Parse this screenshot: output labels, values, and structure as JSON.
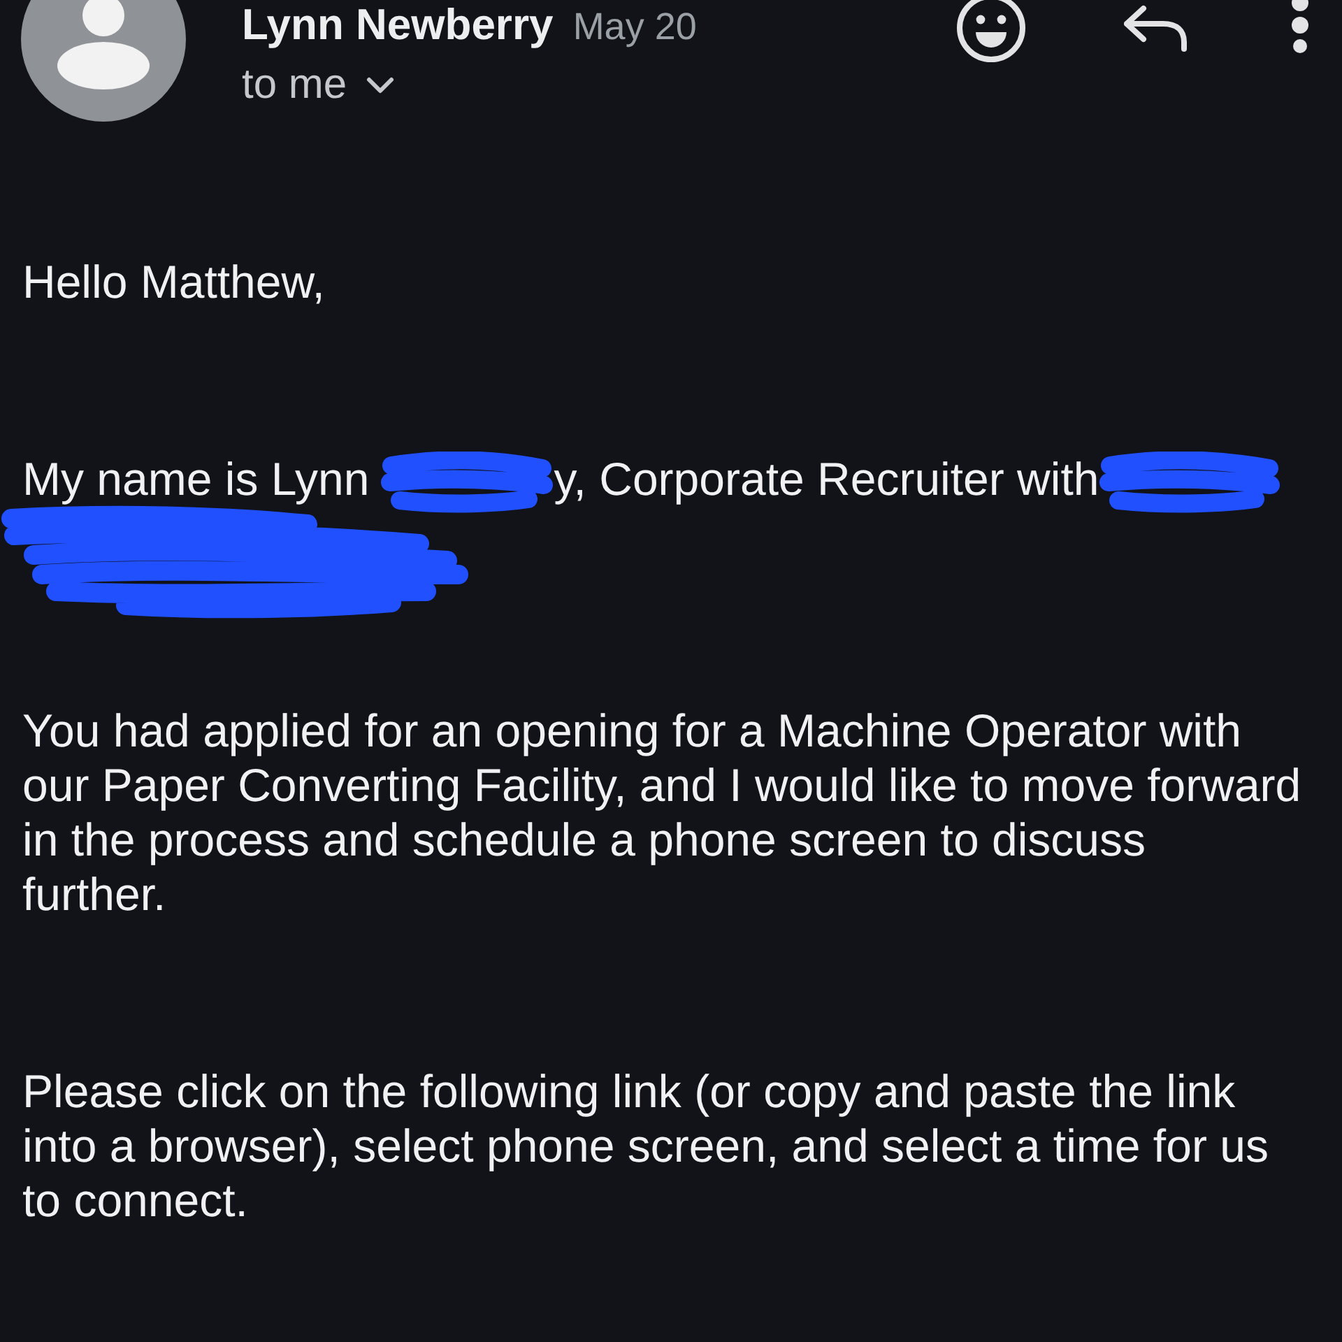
{
  "header": {
    "sender": "Lynn Newberry",
    "date": "May 20",
    "recipient": "to me"
  },
  "body": [
    {
      "kind": "text",
      "text": "Hello Matthew,"
    },
    {
      "kind": "mixed",
      "parts": [
        {
          "kind": "text",
          "text": "My name is Lynn"
        },
        {
          "kind": "redaction"
        },
        {
          "kind": "text",
          "text": "y, Corporate Recruiter with"
        },
        {
          "kind": "redaction"
        },
        {
          "kind": "redaction_line"
        }
      ]
    },
    {
      "kind": "text",
      "text": "You had applied for an opening for a Machine Operator with our Paper Converting Facility, and I would like to move forward in the process and schedule a phone screen to discuss further."
    },
    {
      "kind": "text",
      "text": "Please click on the following link (or copy and paste the link into a browser), select phone screen, and select a time for us to connect."
    }
  ]
}
